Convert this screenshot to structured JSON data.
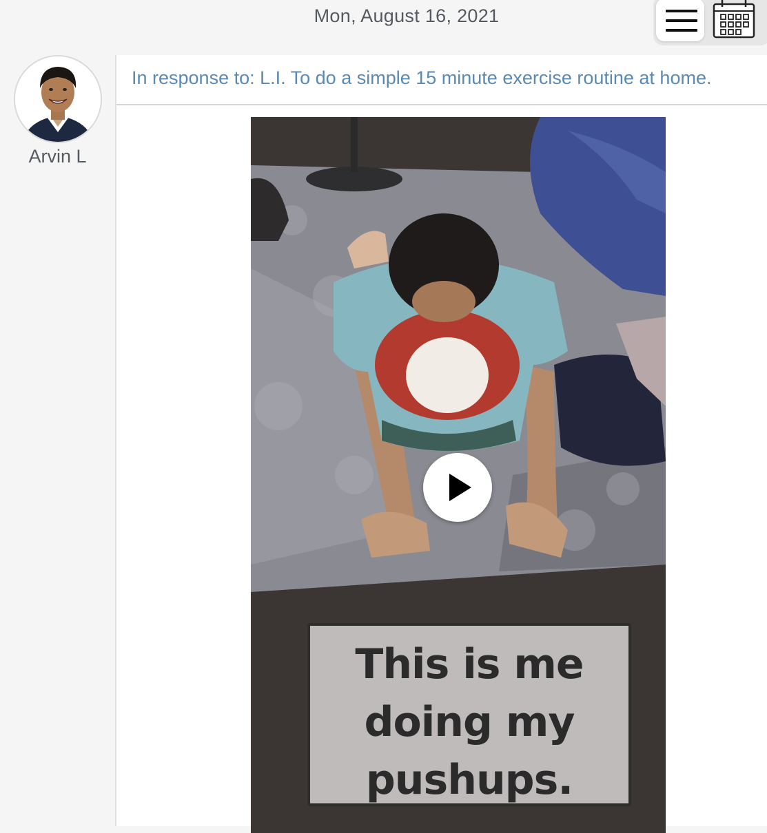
{
  "header": {
    "date": "Mon, August 16, 2021",
    "menu_icon": "hamburger-menu-icon",
    "calendar_icon": "calendar-icon"
  },
  "author": {
    "name": "Arvin L",
    "avatar_icon": "user-avatar"
  },
  "post": {
    "response_to": "In response to: L.I. To do a simple 15 minute exercise routine at home.",
    "video": {
      "caption_line1": "This is me",
      "caption_line2": "doing my",
      "caption_line3": "pushups.",
      "play_icon": "play-icon"
    }
  },
  "colors": {
    "link": "#5a8ab3",
    "text_muted": "#555a60",
    "background": "#f5f5f5"
  }
}
